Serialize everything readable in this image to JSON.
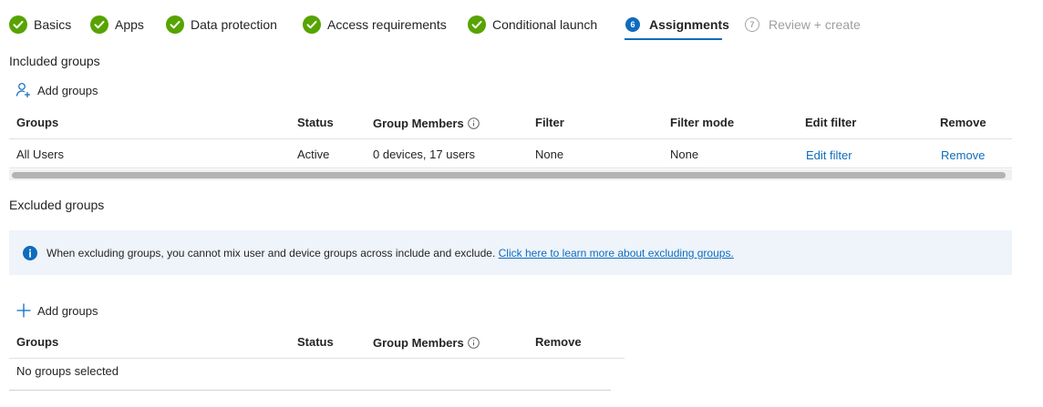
{
  "wizard": {
    "steps": [
      {
        "label": "Basics",
        "state": "done"
      },
      {
        "label": "Apps",
        "state": "done"
      },
      {
        "label": "Data protection",
        "state": "done"
      },
      {
        "label": "Access requirements",
        "state": "done"
      },
      {
        "label": "Conditional launch",
        "state": "done"
      },
      {
        "label": "Assignments",
        "state": "active",
        "number": "6"
      },
      {
        "label": "Review + create",
        "state": "future",
        "number": "7"
      }
    ]
  },
  "included": {
    "title": "Included groups",
    "add_label": "Add groups",
    "headers": {
      "groups": "Groups",
      "status": "Status",
      "members": "Group Members",
      "filter": "Filter",
      "filter_mode": "Filter mode",
      "edit_filter": "Edit filter",
      "remove": "Remove"
    },
    "rows": [
      {
        "group": "All Users",
        "status": "Active",
        "members": "0 devices, 17 users",
        "filter": "None",
        "filter_mode": "None",
        "edit_filter": "Edit filter",
        "remove": "Remove"
      }
    ]
  },
  "excluded": {
    "title": "Excluded groups",
    "info_text": "When excluding groups, you cannot mix user and device groups across include and exclude.",
    "info_link": "Click here to learn more about excluding groups.",
    "add_label": "Add groups",
    "headers": {
      "groups": "Groups",
      "status": "Status",
      "members": "Group Members",
      "remove": "Remove"
    },
    "empty_text": "No groups selected"
  },
  "colors": {
    "accent": "#0f6cbd",
    "success": "#57a300",
    "info_bg": "#eff4fb"
  }
}
